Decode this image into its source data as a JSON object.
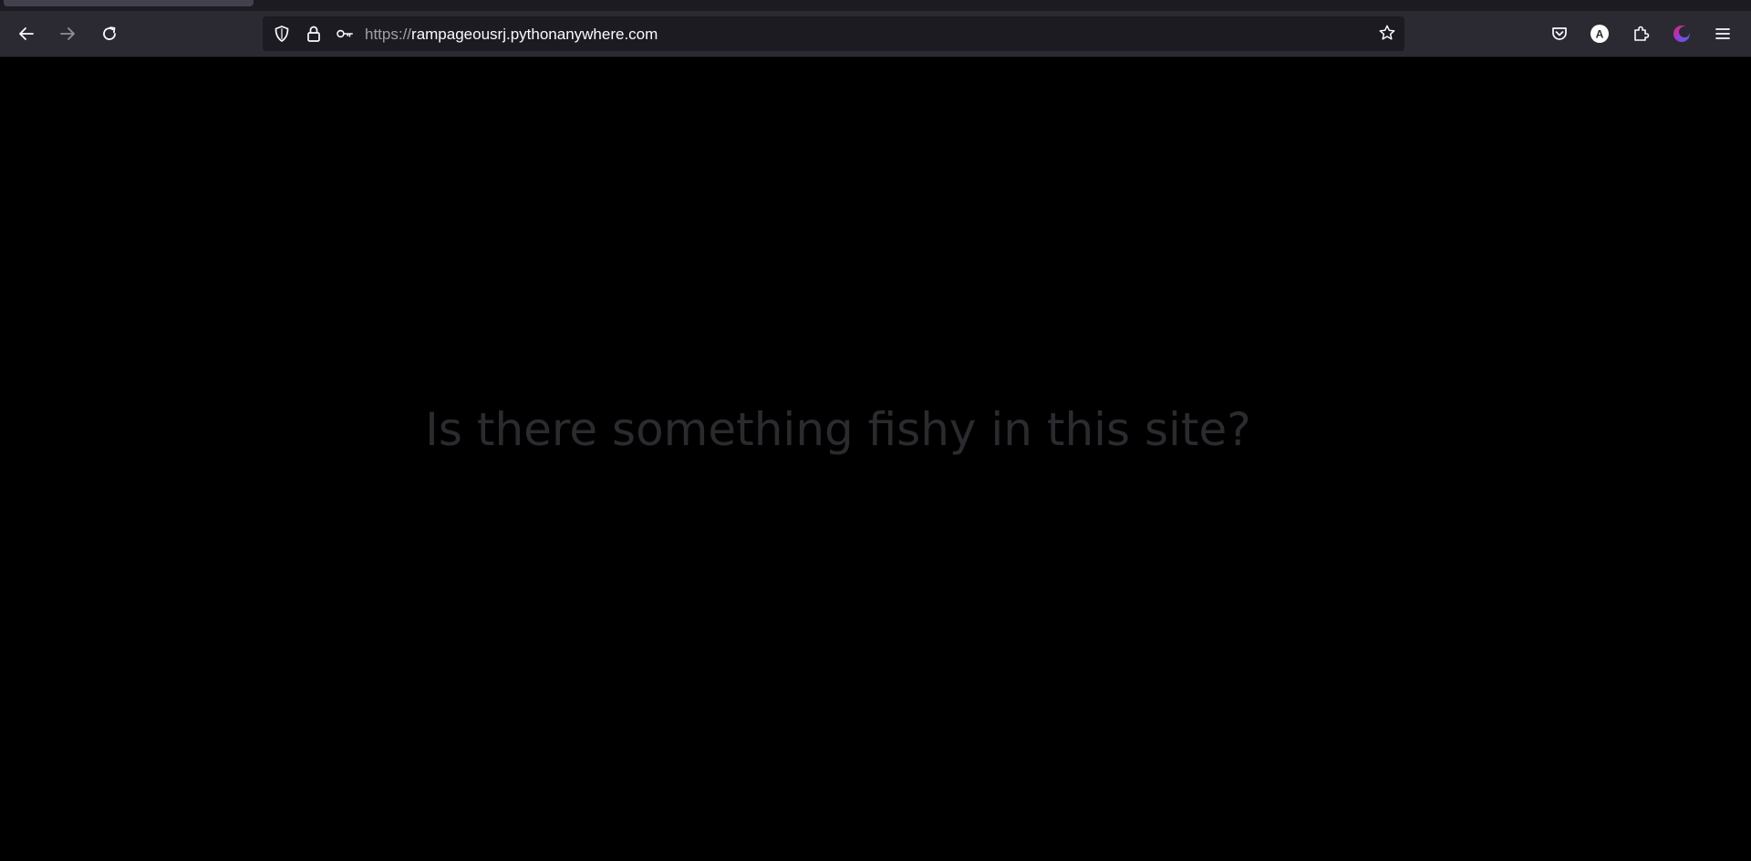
{
  "browser": {
    "url_scheme": "https://",
    "url_host": "rampageousrj.pythonanywhere.com",
    "toolbar_icons": [
      "back-icon",
      "forward-icon",
      "reload-icon",
      "shield-icon",
      "lock-icon",
      "key-icon",
      "star-icon",
      "pocket-icon",
      "account-icon",
      "extensions-icon",
      "colorful-extension-icon",
      "menu-icon"
    ],
    "account_initial": "A",
    "colors": {
      "toolbar": "#2b2a33",
      "urlbar": "#1c1b22",
      "icon": "#fbfbfe",
      "disabled_icon": "#8f8f9d"
    }
  },
  "page": {
    "headline": "Is there something fishy in this site?",
    "colors": {
      "background": "#000000",
      "headline": "#2b2b2f"
    }
  }
}
